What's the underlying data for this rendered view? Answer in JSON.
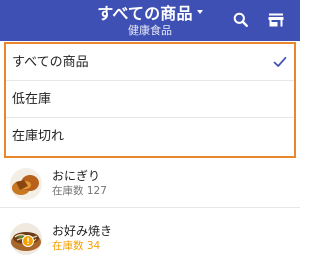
{
  "appbar": {
    "title": "すべての商品",
    "subtitle": "健康食品",
    "background": "#3f50b5",
    "icons": [
      "search-icon",
      "store-icon",
      "caret-down-icon"
    ]
  },
  "menu": {
    "highlight_color": "#e8872c",
    "items": [
      {
        "label": "すべての商品",
        "selected": true
      },
      {
        "label": "低在庫",
        "selected": false
      },
      {
        "label": "在庫切れ",
        "selected": false
      }
    ]
  },
  "products": [
    {
      "name": "おにぎり",
      "stock": "在庫数 127",
      "warning": false
    },
    {
      "name": "お好み焼き",
      "stock": "在庫数 34",
      "warning": true,
      "stock_color": "#f5a000"
    }
  ]
}
